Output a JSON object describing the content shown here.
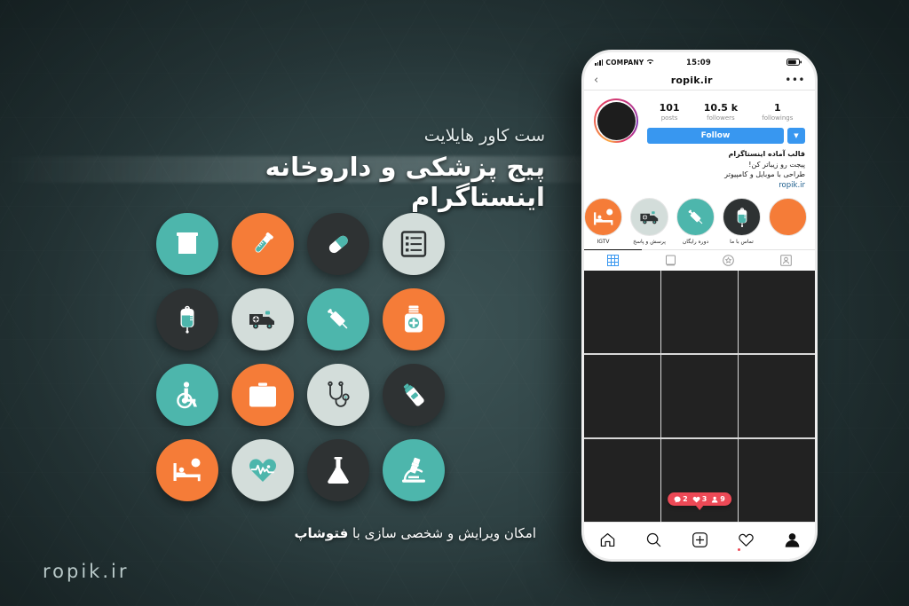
{
  "poster": {
    "subtitle": "ست کاور هایلایت",
    "title": "پیج پزشکی و داروخانه اینستاگرام",
    "footer_text": "امکان ویرایش و شخصی سازی با ",
    "footer_bold": "فتوشاپ",
    "brand": "ropik.ir",
    "colors": {
      "teal": "#4DB6AC",
      "orange": "#F57C38",
      "dark": "#2E3233",
      "light": "#D3DDDA",
      "bg_dark": "#223234",
      "bg_center": "#3C5254"
    }
  },
  "icons": [
    {
      "name": "pharmacy-building-icon",
      "bg": "#4DB6AC",
      "fg": "#ffffff",
      "glyph": "building"
    },
    {
      "name": "test-tube-icon",
      "bg": "#F57C38",
      "fg": "#ffffff",
      "glyph": "tube"
    },
    {
      "name": "pill-capsule-icon",
      "bg": "#2E3233",
      "fg": "#ffffff",
      "glyph": "pill"
    },
    {
      "name": "clipboard-list-icon",
      "bg": "#D3DDDA",
      "fg": "#2E3233",
      "glyph": "list"
    },
    {
      "name": "iv-drip-bag-icon",
      "bg": "#2E3233",
      "fg": "#ffffff",
      "glyph": "iv"
    },
    {
      "name": "ambulance-icon",
      "bg": "#D3DDDA",
      "fg": "#2E3233",
      "glyph": "ambulance"
    },
    {
      "name": "syringe-icon",
      "bg": "#4DB6AC",
      "fg": "#ffffff",
      "glyph": "syringe"
    },
    {
      "name": "medicine-bottle-icon",
      "bg": "#F57C38",
      "fg": "#ffffff",
      "glyph": "bottle"
    },
    {
      "name": "wheelchair-icon",
      "bg": "#4DB6AC",
      "fg": "#ffffff",
      "glyph": "wheelchair"
    },
    {
      "name": "first-aid-kit-icon",
      "bg": "#F57C38",
      "fg": "#ffffff",
      "glyph": "kit"
    },
    {
      "name": "stethoscope-icon",
      "bg": "#D3DDDA",
      "fg": "#2E3233",
      "glyph": "stetho"
    },
    {
      "name": "ointment-tube-icon",
      "bg": "#2E3233",
      "fg": "#ffffff",
      "glyph": "ointment"
    },
    {
      "name": "hospital-bed-icon",
      "bg": "#F57C38",
      "fg": "#ffffff",
      "glyph": "bed"
    },
    {
      "name": "heart-pulse-icon",
      "bg": "#D3DDDA",
      "fg": "#4DB6AC",
      "glyph": "heart"
    },
    {
      "name": "lab-flask-icon",
      "bg": "#2E3233",
      "fg": "#ffffff",
      "glyph": "flask"
    },
    {
      "name": "microscope-icon",
      "bg": "#4DB6AC",
      "fg": "#ffffff",
      "glyph": "micro"
    }
  ],
  "phone": {
    "status": {
      "carrier": "COMPANY",
      "time": "15:09"
    },
    "nav": {
      "title": "ropik.ir"
    },
    "profile": {
      "stats": [
        {
          "num": "101",
          "label": "posts"
        },
        {
          "num": "10.5 k",
          "label": "followers"
        },
        {
          "num": "1",
          "label": "followings"
        }
      ],
      "follow_label": "Follow",
      "bio_line1": "قالب آماده اینستاگرام",
      "bio_line2": "پیجت رو زیباتر کن!",
      "bio_line3": "طراحی با موبایل و کامپیوتر",
      "bio_link": "ropik.ir"
    },
    "highlights": [
      {
        "caption": "IGTV",
        "bg": "#F57C38",
        "glyph": "bed"
      },
      {
        "caption": "پرسش و پاسخ",
        "bg": "#D3DDDA",
        "glyph": "ambulance"
      },
      {
        "caption": "دوره رایگان",
        "bg": "#4DB6AC",
        "glyph": "syringe"
      },
      {
        "caption": "تماس با ما",
        "bg": "#2E3233",
        "glyph": "iv"
      },
      {
        "caption": "",
        "bg": "#F57C38",
        "glyph": "none"
      }
    ],
    "tabs": [
      {
        "name": "grid-tab",
        "active": true
      },
      {
        "name": "reels-tab",
        "active": false
      },
      {
        "name": "tagged-tab",
        "active": false
      },
      {
        "name": "person-tab",
        "active": false
      }
    ],
    "badge": {
      "comments": "2",
      "likes": "3",
      "followers": "9"
    },
    "tabbar": [
      "home-icon",
      "search-icon",
      "add-icon",
      "heart-icon",
      "profile-icon"
    ]
  }
}
